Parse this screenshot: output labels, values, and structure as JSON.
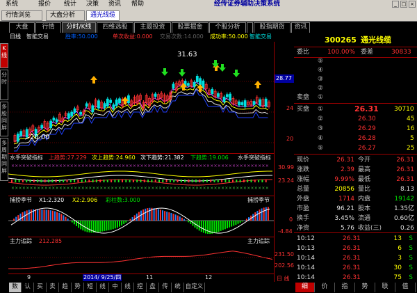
{
  "menu": {
    "items": [
      "系统",
      "报价",
      "统计",
      "决策",
      "资讯",
      "帮助"
    ]
  },
  "app_title": "经传证券辅助决策系统",
  "window_buttons": [
    "_",
    "□",
    "×"
  ],
  "doc_tabs": [
    "行情浏览",
    "大盘分析",
    "通光线缆"
  ],
  "top_tabs": [
    "大盘",
    "行情",
    "分时/K线",
    "四维选股",
    "主题投资",
    "股票掘金",
    "个股分析",
    "",
    "股指期货",
    "资讯"
  ],
  "side_tabs": [
    "K线",
    "分时",
    "多股同屏",
    "多周期同屏"
  ],
  "main_header": {
    "period": "日线",
    "indicator": "智能交易",
    "values": [
      {
        "text": "胜率:50.000",
        "color": "#0060ff"
      },
      {
        "text": "单次收益:0.000",
        "color": "#ff3232"
      },
      {
        "text": "交易次数:14.000",
        "color": "#606060"
      },
      {
        "text": "成功率:50.000",
        "color": "#ffff00"
      },
      {
        "text": "智能交易",
        "color": "#00e0e0"
      }
    ],
    "high_label": "31.63",
    "low_label": "20.00",
    "scale": [
      "28.77",
      "24",
      "20"
    ]
  },
  "panel2": {
    "title": "水手突破指标",
    "values": [
      {
        "text": "上趋势:27.229",
        "color": "#ff3232"
      },
      {
        "text": "次上趋势:24.960",
        "color": "#ffff00"
      },
      {
        "text": "次下趋势:21.382",
        "color": "#ffffff"
      },
      {
        "text": "下趋势:19.006",
        "color": "#00e000"
      }
    ],
    "right_title": "水手突破指标",
    "scale": [
      "30.99",
      "23.24"
    ]
  },
  "panel3": {
    "title": "捕捞季节",
    "values": [
      {
        "text": "X1:2.320",
        "color": "#ffffff"
      },
      {
        "text": "X2:2.906",
        "color": "#ffff00"
      },
      {
        "text": "彩柱数:3.000",
        "color": "#00e000"
      }
    ],
    "right_title": "捕捞季节",
    "scale": [
      "0",
      "-4.84"
    ]
  },
  "panel4": {
    "title": "主力追踪",
    "value": {
      "text": "212.285",
      "color": "#ff3232"
    },
    "right_title": "主力追踪",
    "scale": [
      "231.50",
      "202.56"
    ]
  },
  "x_axis": {
    "labels": [
      "9",
      "2014/ 9/25/四",
      "11",
      "12"
    ],
    "corner": "日 线"
  },
  "bottom_tabs": [
    "数",
    "认",
    "买",
    "卖",
    "趋",
    "势",
    "短",
    "线",
    "中",
    "线",
    "控",
    "盘",
    "传",
    "统",
    "自定义"
  ],
  "quote": {
    "code": "300265",
    "name": "通光线缆",
    "weibi_label": "委比",
    "weibi": "100.00%",
    "weicha_label": "委差",
    "weicha": "30833",
    "sell_label": "卖盘",
    "sells": [
      "⑤",
      "④",
      "③",
      "②",
      "①"
    ],
    "buy_label": "买盘",
    "buys": [
      {
        "price": "26.31",
        "vol": "30710"
      },
      {
        "price": "26.30",
        "vol": "45"
      },
      {
        "price": "26.29",
        "vol": "16"
      },
      {
        "price": "26.28",
        "vol": "5"
      },
      {
        "price": "26.27",
        "vol": "25"
      }
    ],
    "stats": [
      {
        "l1": "现价",
        "v1": "26.31",
        "c1": "#ff3232",
        "l2": "今开",
        "v2": "26.31",
        "c2": "#ff3232"
      },
      {
        "l1": "涨跌",
        "v1": "2.39",
        "c1": "#ff3232",
        "l2": "最高",
        "v2": "26.31",
        "c2": "#ff3232"
      },
      {
        "l1": "涨幅",
        "v1": "9.99%",
        "c1": "#ff3232",
        "l2": "最低",
        "v2": "26.31",
        "c2": "#ff3232"
      },
      {
        "l1": "总量",
        "v1": "20856",
        "c1": "#ffff00",
        "l2": "量比",
        "v2": "8.13",
        "c2": "#e0e0e0"
      },
      {
        "l1": "外盘",
        "v1": "1714",
        "c1": "#ff3232",
        "l2": "内盘",
        "v2": "19142",
        "c2": "#00e000"
      },
      {
        "l1": "市盈",
        "v1": "96.21",
        "c1": "#e0e0e0",
        "l2": "股本",
        "v2": "1.35亿",
        "c2": "#e0e0e0"
      },
      {
        "l1": "换手",
        "v1": "3.45%",
        "c1": "#e0e0e0",
        "l2": "流通",
        "v2": "0.60亿",
        "c2": "#e0e0e0"
      },
      {
        "l1": "净资",
        "v1": "5.76",
        "c1": "#e0e0e0",
        "l2": "收益(三)",
        "v2": "0.26",
        "c2": "#e0e0e0"
      }
    ],
    "ticks": [
      {
        "time": "10:12",
        "price": "26.31",
        "vol": "13",
        "side": "S"
      },
      {
        "time": "10:13",
        "price": "26.31",
        "vol": "6",
        "side": "S"
      },
      {
        "time": "10:14",
        "price": "26.31",
        "vol": "3",
        "side": "S"
      },
      {
        "time": "10:14",
        "price": "26.31",
        "vol": "30",
        "side": "S"
      },
      {
        "time": "10:14",
        "price": "26.31",
        "vol": "75",
        "side": "S"
      }
    ],
    "tabs": [
      "细",
      "价",
      "指",
      "势",
      "联",
      "值"
    ]
  }
}
